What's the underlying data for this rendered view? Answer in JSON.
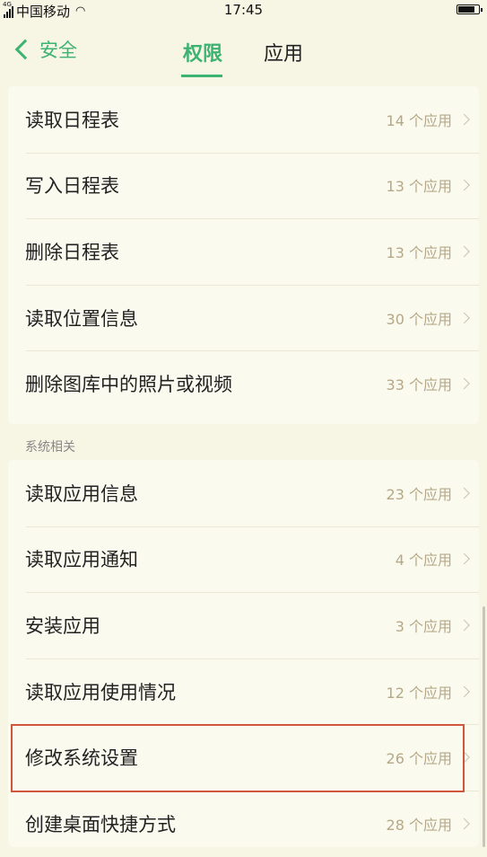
{
  "status": {
    "network_tag": "4G",
    "carrier": "中国移动",
    "wifi_icon": "wifi-icon",
    "time": "17:45",
    "battery_icon": "battery-icon"
  },
  "header": {
    "back_label": "安全",
    "tabs": [
      {
        "label": "权限",
        "active": true
      },
      {
        "label": "应用",
        "active": false
      }
    ]
  },
  "colors": {
    "accent": "#3cb371",
    "highlight_border": "#d2553e",
    "count_text": "#b5a888"
  },
  "list1": [
    {
      "label": "读取日程表",
      "count": "14 个应用"
    },
    {
      "label": "写入日程表",
      "count": "13 个应用"
    },
    {
      "label": "删除日程表",
      "count": "13 个应用"
    },
    {
      "label": "读取位置信息",
      "count": "30 个应用"
    },
    {
      "label": "删除图库中的照片或视频",
      "count": "33 个应用"
    }
  ],
  "section2": {
    "title": "系统相关"
  },
  "list2": [
    {
      "label": "读取应用信息",
      "count": "23 个应用"
    },
    {
      "label": "读取应用通知",
      "count": "4 个应用"
    },
    {
      "label": "安装应用",
      "count": "3 个应用"
    },
    {
      "label": "读取应用使用情况",
      "count": "12 个应用"
    },
    {
      "label": "修改系统设置",
      "count": "26 个应用",
      "highlighted": true
    },
    {
      "label": "创建桌面快捷方式",
      "count": "28 个应用"
    }
  ]
}
